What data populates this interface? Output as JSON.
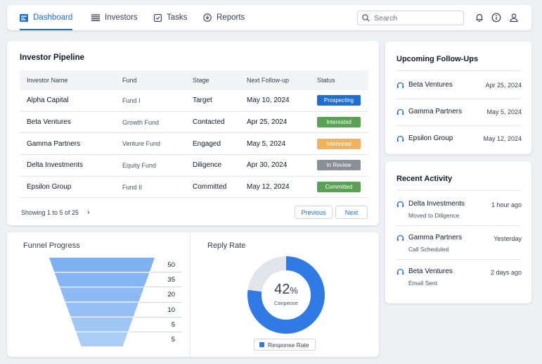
{
  "nav": {
    "items": [
      {
        "label": "Dashboard",
        "icon": "dashboard-icon",
        "active": true
      },
      {
        "label": "Investors",
        "icon": "list-icon",
        "active": false
      },
      {
        "label": "Tasks",
        "icon": "task-icon",
        "active": false
      },
      {
        "label": "Reports",
        "icon": "reports-icon",
        "active": false
      }
    ],
    "search_placeholder": "Search",
    "accent": "#1f6fd1"
  },
  "pipeline": {
    "title": "Investor Pipeline",
    "columns": [
      "Investor Name",
      "Fund",
      "Stage",
      "Next Follow-up",
      "Status"
    ],
    "rows": [
      {
        "name": "Alpha Capital",
        "fund": "Fund I",
        "stage": "Target",
        "followup": "May 10, 2024",
        "status": "Prospecting",
        "status_color": "#1f6fd1"
      },
      {
        "name": "Beta Ventures",
        "fund": "Growth Fund",
        "stage": "Contacted",
        "followup": "Apr 25, 2024",
        "status": "Interested",
        "status_color": "#5aa055"
      },
      {
        "name": "Gamma Partners",
        "fund": "Venture Fund",
        "stage": "Engaged",
        "followup": "May 5, 2024",
        "status": "Interested",
        "status_color": "#f0b35b"
      },
      {
        "name": "Delta Investments",
        "fund": "Equity Fund",
        "stage": "Diligence",
        "followup": "Apr 30, 2024",
        "status": "In Review",
        "status_color": "#8a8f96"
      },
      {
        "name": "Epsilon Group",
        "fund": "Fund II",
        "stage": "Committed",
        "followup": "May 12, 2024",
        "status": "Committed",
        "status_color": "#5aa055"
      }
    ],
    "showing": "Showing 1 to 5 of 25",
    "previous_label": "Previous",
    "next_label": "Next"
  },
  "funnel": {
    "title": "Funnel Progress",
    "values": [
      "50",
      "35",
      "20",
      "10",
      "5",
      "5"
    ]
  },
  "reply": {
    "title": "Reply Rate",
    "percent": 42,
    "value_text": "42",
    "percent_sign": "%",
    "sublabel": "Canpeose",
    "legend": "Response Rate",
    "color": "#2f7ae5",
    "track_color": "#e2e5e9"
  },
  "followups": {
    "title": "Upcoming Follow-Ups",
    "items": [
      {
        "name": "Beta Ventures",
        "date": "Apr 25, 2024"
      },
      {
        "name": "Gamma Partners",
        "date": "May 5, 2024"
      },
      {
        "name": "Epsilon Group",
        "date": "May 12, 2024"
      }
    ]
  },
  "activity": {
    "title": "Recent Activity",
    "items": [
      {
        "name": "Delta Investments",
        "time": "1 hour ago",
        "detail": "Moved to Diligence"
      },
      {
        "name": "Gamma Partners",
        "time": "Yesterday",
        "detail": "Call Scheduled"
      },
      {
        "name": "Beta Ventures",
        "time": "2 days ago",
        "detail": "Email Sent"
      }
    ]
  }
}
